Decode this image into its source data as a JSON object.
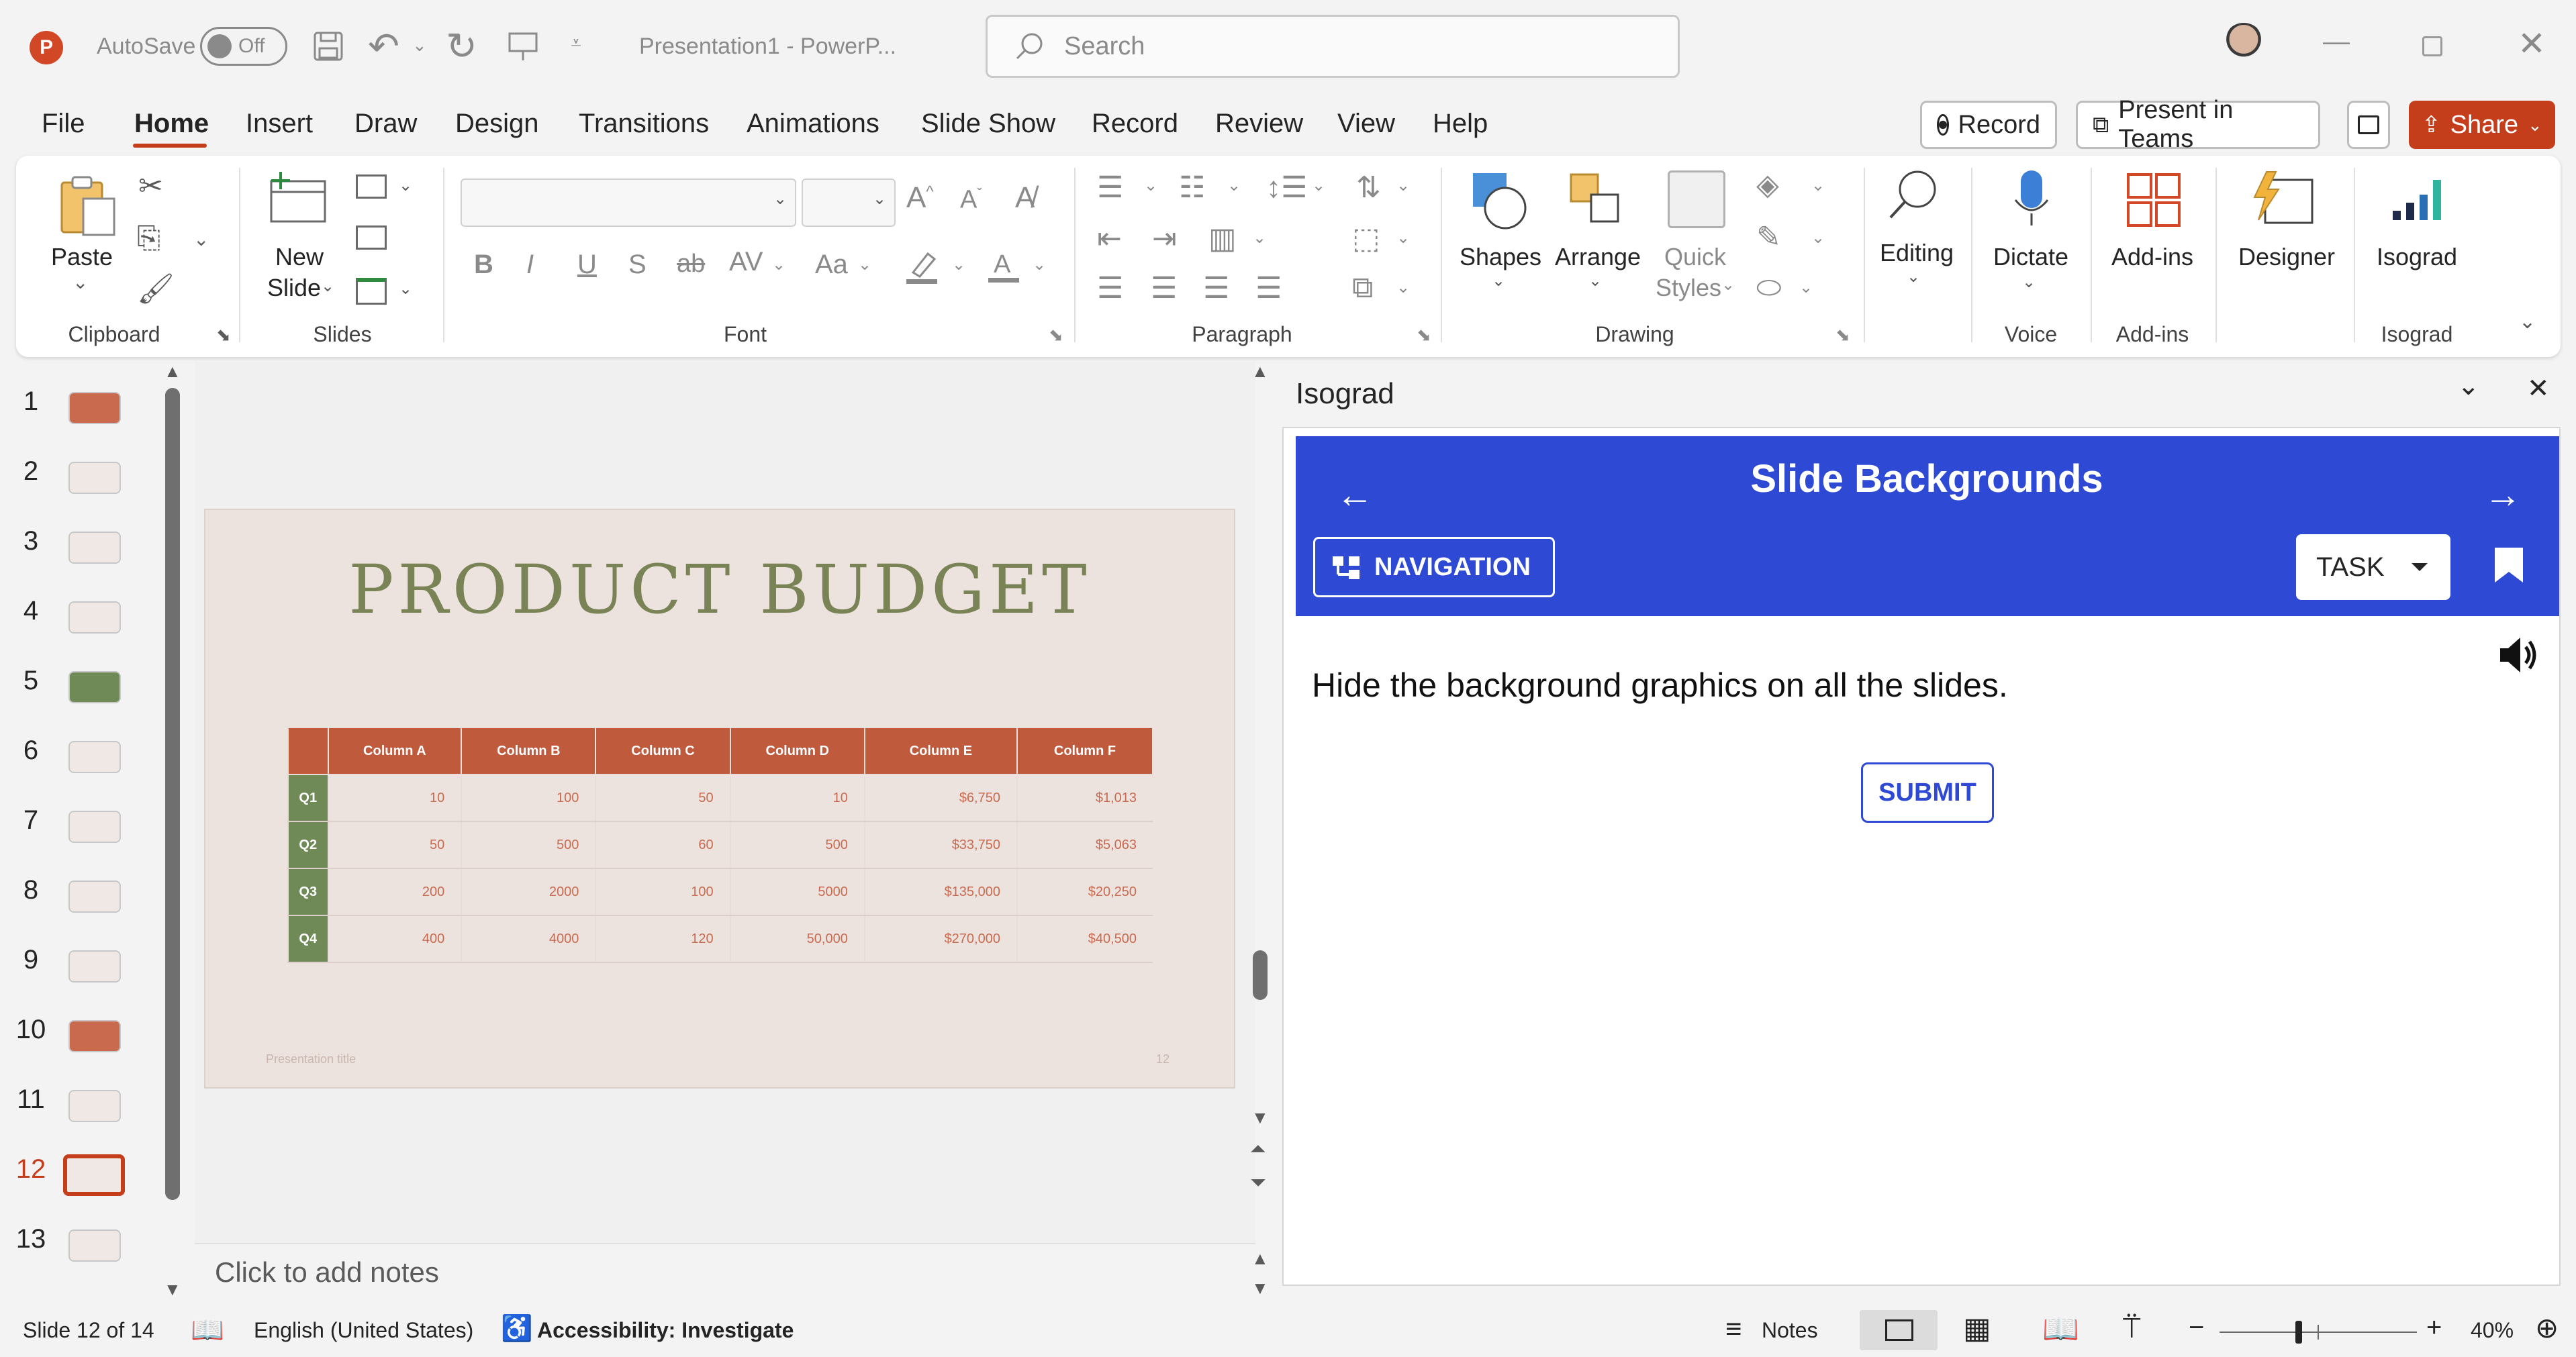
{
  "titlebar": {
    "app_icon": "powerpoint-logo",
    "autosave_label": "AutoSave",
    "autosave_state": "Off",
    "doc_title": "Presentation1  -  PowerP...",
    "search_placeholder": "Search",
    "window_controls": [
      "minimize-icon",
      "restore-icon",
      "close-icon"
    ]
  },
  "menu": {
    "tabs": [
      "File",
      "Home",
      "Insert",
      "Draw",
      "Design",
      "Transitions",
      "Animations",
      "Slide Show",
      "Record",
      "Review",
      "View",
      "Help"
    ],
    "active_tab": "Home",
    "record_label": "Record",
    "present_teams_label": "Present in Teams",
    "share_label": "Share"
  },
  "ribbon": {
    "clipboard": {
      "paste": "Paste",
      "group": "Clipboard"
    },
    "slides": {
      "new_slide_1": "New",
      "new_slide_2": "Slide",
      "group": "Slides"
    },
    "font": {
      "group": "Font"
    },
    "paragraph": {
      "group": "Paragraph"
    },
    "drawing": {
      "shapes": "Shapes",
      "arrange": "Arrange",
      "quick_1": "Quick",
      "quick_2": "Styles",
      "group": "Drawing"
    },
    "editing": {
      "label": "Editing"
    },
    "voice": {
      "dictate": "Dictate",
      "group": "Voice"
    },
    "addins": {
      "label": "Add-ins",
      "group": "Add-ins"
    },
    "designer": {
      "label": "Designer"
    },
    "isograd": {
      "label": "Isograd",
      "group": "Isograd"
    }
  },
  "slides_panel": {
    "numbers": [
      "1",
      "2",
      "3",
      "4",
      "5",
      "6",
      "7",
      "8",
      "9",
      "10",
      "11",
      "12",
      "13"
    ],
    "selected": "12"
  },
  "slide": {
    "title": "PRODUCT BUDGET",
    "footer_left": "Presentation title",
    "footer_right": "12",
    "table": {
      "headers": [
        "",
        "Column A",
        "Column B",
        "Column C",
        "Column D",
        "Column E",
        "Column F"
      ],
      "rows": [
        [
          "Q1",
          "10",
          "100",
          "50",
          "10",
          "$6,750",
          "$1,013"
        ],
        [
          "Q2",
          "50",
          "500",
          "60",
          "500",
          "$33,750",
          "$5,063"
        ],
        [
          "Q3",
          "200",
          "2000",
          "100",
          "5000",
          "$135,000",
          "$20,250"
        ],
        [
          "Q4",
          "400",
          "4000",
          "120",
          "50,000",
          "$270,000",
          "$40,500"
        ]
      ]
    }
  },
  "notes": {
    "placeholder": "Click to add notes"
  },
  "pane": {
    "title": "Isograd",
    "heading": "Slide Backgrounds",
    "nav_label": "NAVIGATION",
    "task_label": "TASK",
    "instruction": "Hide the background graphics on all the slides.",
    "submit_label": "SUBMIT"
  },
  "statusbar": {
    "slide_info": "Slide 12 of 14",
    "language": "English (United States)",
    "accessibility": "Accessibility: Investigate",
    "notes": "Notes",
    "zoom": "40%",
    "zoom_level": 0.4
  },
  "colors": {
    "accent": "#c43e1c",
    "pane_header": "#2e49d4",
    "table_header": "#c05a3d",
    "table_rowhead": "#6f8a56",
    "slide_title": "#7a8355"
  }
}
